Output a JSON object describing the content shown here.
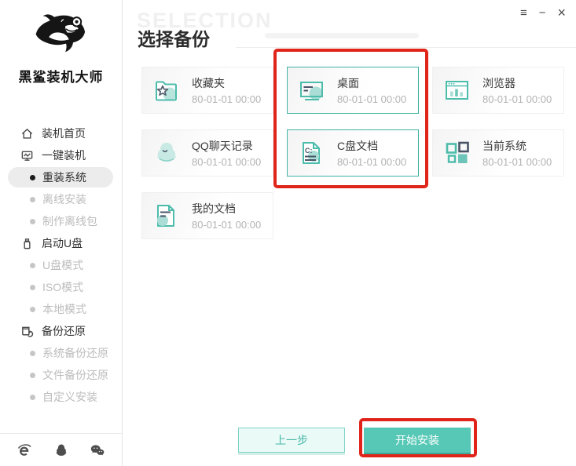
{
  "window_controls": {
    "menu": "≡",
    "minimize": "−",
    "close": "×"
  },
  "sidebar": {
    "logo_text": "黑鲨装机大师",
    "items": [
      {
        "label": "装机首页",
        "icon": "home-icon",
        "state": "normal"
      },
      {
        "label": "一键装机",
        "icon": "monitor-icon",
        "state": "normal"
      },
      {
        "label": "重装系统",
        "state": "active"
      },
      {
        "label": "离线安装",
        "state": "disabled"
      },
      {
        "label": "制作离线包",
        "state": "disabled"
      },
      {
        "label": "启动U盘",
        "icon": "usb-icon",
        "state": "normal"
      },
      {
        "label": "U盘模式",
        "state": "disabled"
      },
      {
        "label": "ISO模式",
        "state": "disabled"
      },
      {
        "label": "本地模式",
        "state": "disabled"
      },
      {
        "label": "备份还原",
        "icon": "backup-restore-icon",
        "state": "normal"
      },
      {
        "label": "系统备份还原",
        "state": "disabled"
      },
      {
        "label": "文件备份还原",
        "state": "disabled"
      },
      {
        "label": "自定义安装",
        "state": "disabled"
      }
    ],
    "footer_icons": [
      "ie-icon",
      "qq-icon",
      "wechat-icon"
    ]
  },
  "main": {
    "watermark": "SELECTION",
    "title": "选择备份",
    "cards": [
      {
        "label": "收藏夹",
        "date": "80-01-01 00:00",
        "icon": "favorites-folder-icon",
        "selected": false
      },
      {
        "label": "桌面",
        "date": "80-01-01 00:00",
        "icon": "desktop-icon",
        "selected": true
      },
      {
        "label": "浏览器",
        "date": "80-01-01 00:00",
        "icon": "browser-icon",
        "selected": false
      },
      {
        "label": "QQ聊天记录",
        "date": "80-01-01 00:00",
        "icon": "qq-chat-icon",
        "selected": false
      },
      {
        "label": "C盘文档",
        "date": "80-01-01 00:00",
        "icon": "c-drive-doc-icon",
        "selected": true
      },
      {
        "label": "当前系统",
        "date": "80-01-01 00:00",
        "icon": "current-system-icon",
        "selected": false
      },
      {
        "label": "我的文档",
        "date": "80-01-01 00:00",
        "icon": "my-documents-icon",
        "selected": false
      }
    ],
    "buttons": {
      "prev": "上一步",
      "start": "开始安装"
    }
  },
  "colors": {
    "accent": "#4cbcab",
    "accent_dark": "#3ea795",
    "selected_border": "#3fb3a3",
    "annotation_red": "#e0241a",
    "disabled_text": "#bcbcbc"
  }
}
